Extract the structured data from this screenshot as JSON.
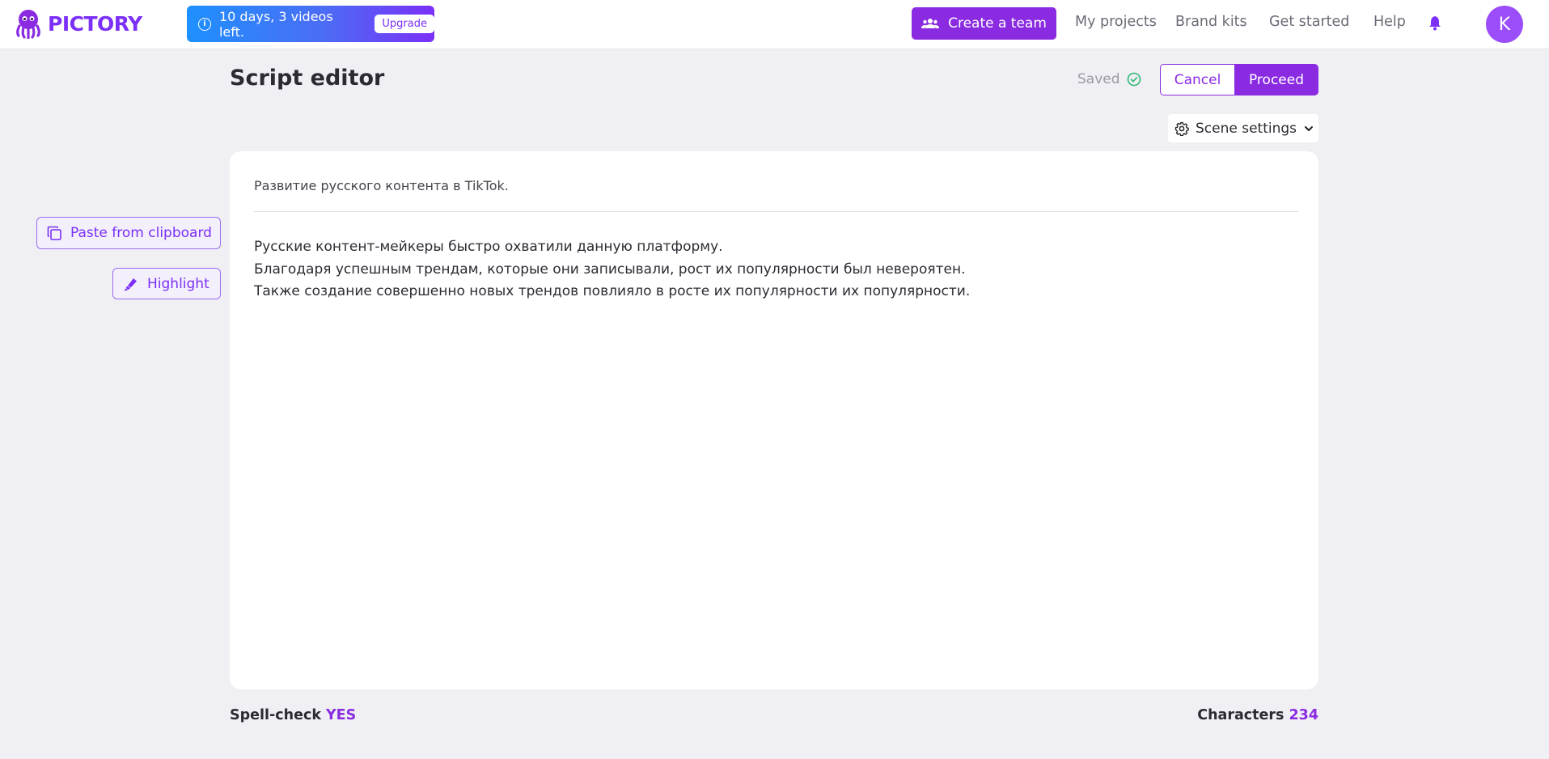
{
  "app": {
    "brand": "PICTORY",
    "accent_color": "#8a2be2"
  },
  "trial_banner": {
    "text": "10 days, 3 videos left.",
    "upgrade_label": "Upgrade",
    "icon": "info-icon"
  },
  "nav": {
    "create_team_label": "Create a team",
    "links": [
      "My projects",
      "Brand kits",
      "Get started",
      "Help"
    ],
    "avatar_initial": "K"
  },
  "header": {
    "title": "Script editor",
    "saved_label": "Saved",
    "cancel_label": "Cancel",
    "proceed_label": "Proceed",
    "scene_settings_label": "Scene settings"
  },
  "sidebar": {
    "paste_label": "Paste from clipboard",
    "highlight_label": "Highlight"
  },
  "editor": {
    "title": "Развитие русского контента в TikTok.",
    "lines": [
      "Русские контент-мейкеры быстро охватили данную платформу.",
      "Благодаря успешным трендам, которые они записывали, рост их популярности был невероятен.",
      "Также создание совершенно новых трендов повлияло в росте их популярности их популярности."
    ]
  },
  "footer": {
    "spell_label": "Spell-check",
    "spell_value": "YES",
    "chars_label": "Characters",
    "chars_value": "234"
  }
}
